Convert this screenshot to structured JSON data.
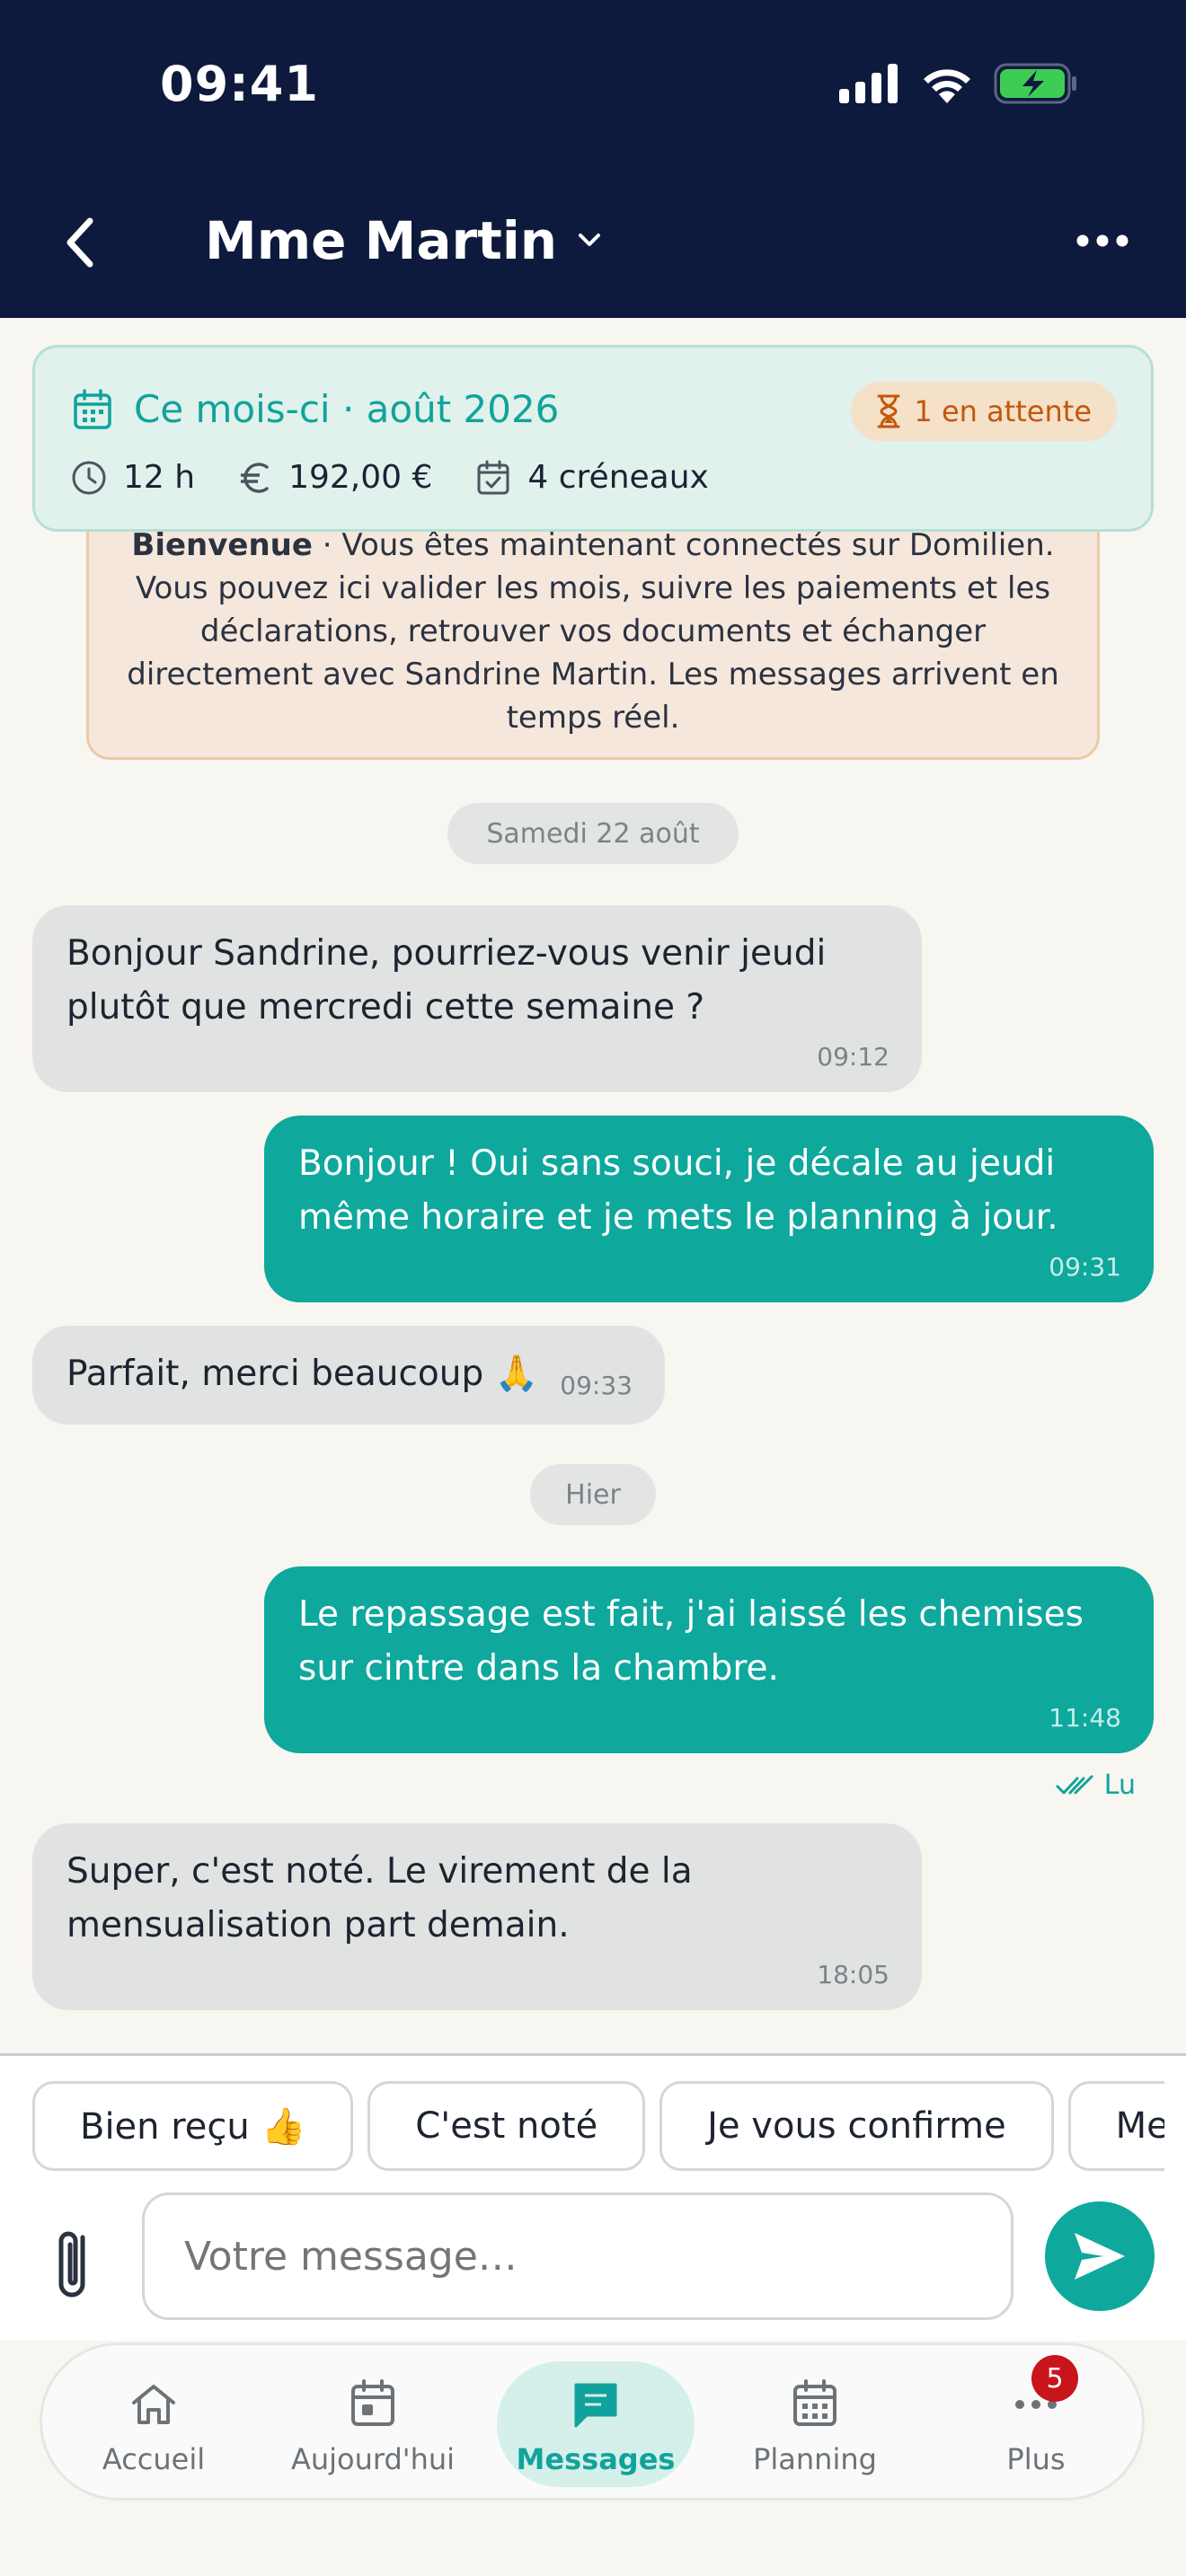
{
  "status_bar": {
    "time": "09:41"
  },
  "header": {
    "title": "Mme Martin"
  },
  "summary": {
    "title": "Ce mois-ci · août 2026",
    "pending": "1 en attente",
    "hours": "12 h",
    "amount": "192,00 €",
    "slots": "4 créneaux"
  },
  "welcome": {
    "bold": "Bienvenue",
    "text": " · Vous êtes maintenant connectés sur Domilien. Vous pouvez ici valider les mois, suivre les paiements et les déclarations, retrouver vos documents et échanger directement avec Sandrine Martin. Les messages arrivent en temps réel."
  },
  "date_chips": [
    "Samedi 22 août",
    "Hier"
  ],
  "messages": [
    {
      "dir": "in",
      "text": "Bonjour Sandrine, pourriez-vous venir jeudi plutôt que mercredi cette semaine ?",
      "time": "09:12"
    },
    {
      "dir": "out",
      "text": "Bonjour ! Oui sans souci, je décale au jeudi même horaire et je mets le planning à jour.",
      "time": "09:31"
    },
    {
      "dir": "in",
      "text": "Parfait, merci beaucoup 🙏",
      "time": "09:33"
    },
    {
      "dir": "out",
      "text": "Le repassage est fait, j'ai laissé les chemises sur cintre dans la chambre.",
      "time": "11:48"
    },
    {
      "dir": "in",
      "text": "Super, c'est noté. Le virement de la mensualisation part demain.",
      "time": "18:05"
    }
  ],
  "read_receipt": "Lu",
  "quick_replies": [
    "Bien reçu 👍",
    "C'est noté",
    "Je vous confirme",
    "Merc"
  ],
  "composer": {
    "placeholder": "Votre message…"
  },
  "tabs": [
    {
      "label": "Accueil",
      "icon": "home-icon"
    },
    {
      "label": "Aujourd'hui",
      "icon": "calendar-today-icon"
    },
    {
      "label": "Messages",
      "icon": "chat-icon"
    },
    {
      "label": "Planning",
      "icon": "calendar-grid-icon"
    },
    {
      "label": "Plus",
      "icon": "more-dots-icon"
    }
  ],
  "more_badge": "5",
  "colors": {
    "header_bg": "#0e1a3d",
    "accent": "#0ea89d",
    "badge": "#c8141b"
  }
}
